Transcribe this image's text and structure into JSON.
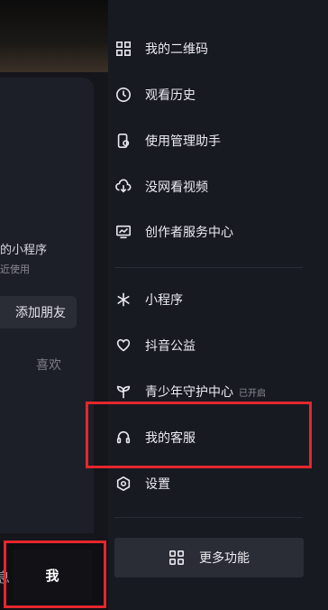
{
  "left_panel": {
    "mini_program_title": "的小程序",
    "mini_program_sub": "近使用",
    "add_friend": "添加朋友",
    "likes": "喜欢",
    "tab_other": "息",
    "tab_me": "我"
  },
  "drawer": {
    "items": [
      {
        "label": "我的二维码",
        "icon": "qr-code-icon"
      },
      {
        "label": "观看历史",
        "icon": "clock-icon"
      },
      {
        "label": "使用管理助手",
        "icon": "phone-manage-icon"
      },
      {
        "label": "没网看视频",
        "icon": "cloud-download-icon"
      },
      {
        "label": "创作者服务中心",
        "icon": "chart-screen-icon"
      },
      {
        "label": "小程序",
        "icon": "mini-program-icon"
      },
      {
        "label": "抖音公益",
        "icon": "heart-hands-icon"
      },
      {
        "label": "青少年守护中心",
        "icon": "sprout-icon",
        "badge": "已开启"
      },
      {
        "label": "我的客服",
        "icon": "headset-icon"
      },
      {
        "label": "设置",
        "icon": "settings-hex-icon"
      }
    ],
    "more_button": "更多功能"
  },
  "colors": {
    "highlight": "#e6262d",
    "drawer_bg": "#181a22"
  }
}
